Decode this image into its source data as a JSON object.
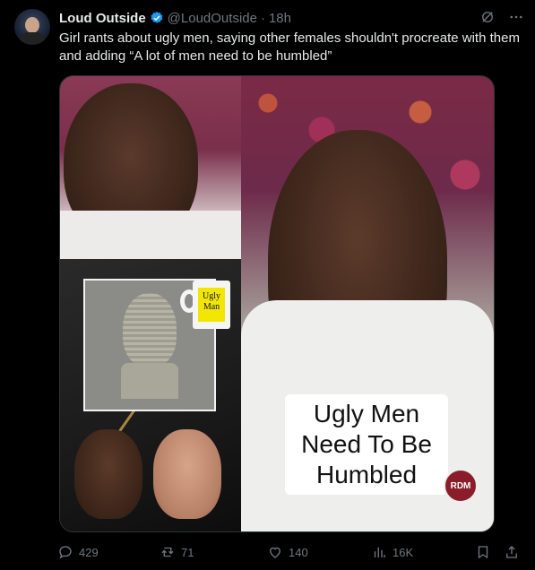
{
  "author": {
    "name": "Loud Outside",
    "handle": "@LoudOutside",
    "separator": "·",
    "time": "18h",
    "verified": true
  },
  "post": {
    "text": "Girl rants about ugly men, saying other females shouldn't procreate with them and adding “A lot of men need to be humbled”"
  },
  "media": {
    "mug_text": "Ugly Man",
    "caption": "Ugly Men Need To Be Humbled",
    "logo_text": "RDM"
  },
  "actions": {
    "replies": "429",
    "reposts": "71",
    "likes": "140",
    "views": "16K"
  },
  "colors": {
    "background": "#000000",
    "text": "#e7e9ea",
    "muted": "#71767b",
    "verified": "#1d9bf0"
  }
}
